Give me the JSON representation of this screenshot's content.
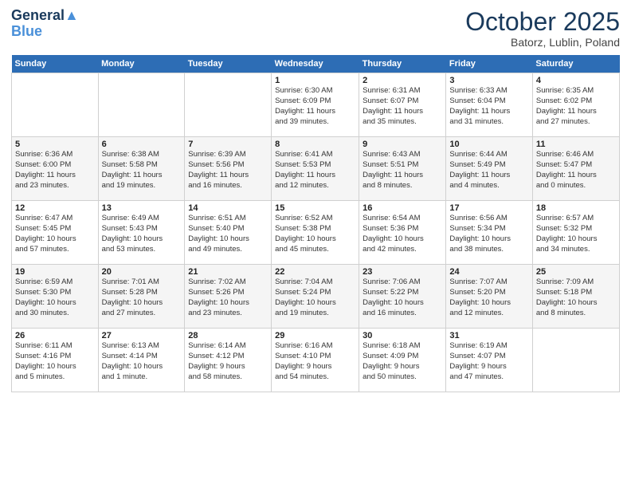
{
  "header": {
    "logo_line1": "General",
    "logo_line2": "Blue",
    "month_title": "October 2025",
    "location": "Batorz, Lublin, Poland"
  },
  "days_of_week": [
    "Sunday",
    "Monday",
    "Tuesday",
    "Wednesday",
    "Thursday",
    "Friday",
    "Saturday"
  ],
  "weeks": [
    [
      {
        "day": "",
        "info": ""
      },
      {
        "day": "",
        "info": ""
      },
      {
        "day": "",
        "info": ""
      },
      {
        "day": "1",
        "info": "Sunrise: 6:30 AM\nSunset: 6:09 PM\nDaylight: 11 hours\nand 39 minutes."
      },
      {
        "day": "2",
        "info": "Sunrise: 6:31 AM\nSunset: 6:07 PM\nDaylight: 11 hours\nand 35 minutes."
      },
      {
        "day": "3",
        "info": "Sunrise: 6:33 AM\nSunset: 6:04 PM\nDaylight: 11 hours\nand 31 minutes."
      },
      {
        "day": "4",
        "info": "Sunrise: 6:35 AM\nSunset: 6:02 PM\nDaylight: 11 hours\nand 27 minutes."
      }
    ],
    [
      {
        "day": "5",
        "info": "Sunrise: 6:36 AM\nSunset: 6:00 PM\nDaylight: 11 hours\nand 23 minutes."
      },
      {
        "day": "6",
        "info": "Sunrise: 6:38 AM\nSunset: 5:58 PM\nDaylight: 11 hours\nand 19 minutes."
      },
      {
        "day": "7",
        "info": "Sunrise: 6:39 AM\nSunset: 5:56 PM\nDaylight: 11 hours\nand 16 minutes."
      },
      {
        "day": "8",
        "info": "Sunrise: 6:41 AM\nSunset: 5:53 PM\nDaylight: 11 hours\nand 12 minutes."
      },
      {
        "day": "9",
        "info": "Sunrise: 6:43 AM\nSunset: 5:51 PM\nDaylight: 11 hours\nand 8 minutes."
      },
      {
        "day": "10",
        "info": "Sunrise: 6:44 AM\nSunset: 5:49 PM\nDaylight: 11 hours\nand 4 minutes."
      },
      {
        "day": "11",
        "info": "Sunrise: 6:46 AM\nSunset: 5:47 PM\nDaylight: 11 hours\nand 0 minutes."
      }
    ],
    [
      {
        "day": "12",
        "info": "Sunrise: 6:47 AM\nSunset: 5:45 PM\nDaylight: 10 hours\nand 57 minutes."
      },
      {
        "day": "13",
        "info": "Sunrise: 6:49 AM\nSunset: 5:43 PM\nDaylight: 10 hours\nand 53 minutes."
      },
      {
        "day": "14",
        "info": "Sunrise: 6:51 AM\nSunset: 5:40 PM\nDaylight: 10 hours\nand 49 minutes."
      },
      {
        "day": "15",
        "info": "Sunrise: 6:52 AM\nSunset: 5:38 PM\nDaylight: 10 hours\nand 45 minutes."
      },
      {
        "day": "16",
        "info": "Sunrise: 6:54 AM\nSunset: 5:36 PM\nDaylight: 10 hours\nand 42 minutes."
      },
      {
        "day": "17",
        "info": "Sunrise: 6:56 AM\nSunset: 5:34 PM\nDaylight: 10 hours\nand 38 minutes."
      },
      {
        "day": "18",
        "info": "Sunrise: 6:57 AM\nSunset: 5:32 PM\nDaylight: 10 hours\nand 34 minutes."
      }
    ],
    [
      {
        "day": "19",
        "info": "Sunrise: 6:59 AM\nSunset: 5:30 PM\nDaylight: 10 hours\nand 30 minutes."
      },
      {
        "day": "20",
        "info": "Sunrise: 7:01 AM\nSunset: 5:28 PM\nDaylight: 10 hours\nand 27 minutes."
      },
      {
        "day": "21",
        "info": "Sunrise: 7:02 AM\nSunset: 5:26 PM\nDaylight: 10 hours\nand 23 minutes."
      },
      {
        "day": "22",
        "info": "Sunrise: 7:04 AM\nSunset: 5:24 PM\nDaylight: 10 hours\nand 19 minutes."
      },
      {
        "day": "23",
        "info": "Sunrise: 7:06 AM\nSunset: 5:22 PM\nDaylight: 10 hours\nand 16 minutes."
      },
      {
        "day": "24",
        "info": "Sunrise: 7:07 AM\nSunset: 5:20 PM\nDaylight: 10 hours\nand 12 minutes."
      },
      {
        "day": "25",
        "info": "Sunrise: 7:09 AM\nSunset: 5:18 PM\nDaylight: 10 hours\nand 8 minutes."
      }
    ],
    [
      {
        "day": "26",
        "info": "Sunrise: 6:11 AM\nSunset: 4:16 PM\nDaylight: 10 hours\nand 5 minutes."
      },
      {
        "day": "27",
        "info": "Sunrise: 6:13 AM\nSunset: 4:14 PM\nDaylight: 10 hours\nand 1 minute."
      },
      {
        "day": "28",
        "info": "Sunrise: 6:14 AM\nSunset: 4:12 PM\nDaylight: 9 hours\nand 58 minutes."
      },
      {
        "day": "29",
        "info": "Sunrise: 6:16 AM\nSunset: 4:10 PM\nDaylight: 9 hours\nand 54 minutes."
      },
      {
        "day": "30",
        "info": "Sunrise: 6:18 AM\nSunset: 4:09 PM\nDaylight: 9 hours\nand 50 minutes."
      },
      {
        "day": "31",
        "info": "Sunrise: 6:19 AM\nSunset: 4:07 PM\nDaylight: 9 hours\nand 47 minutes."
      },
      {
        "day": "",
        "info": ""
      }
    ]
  ]
}
